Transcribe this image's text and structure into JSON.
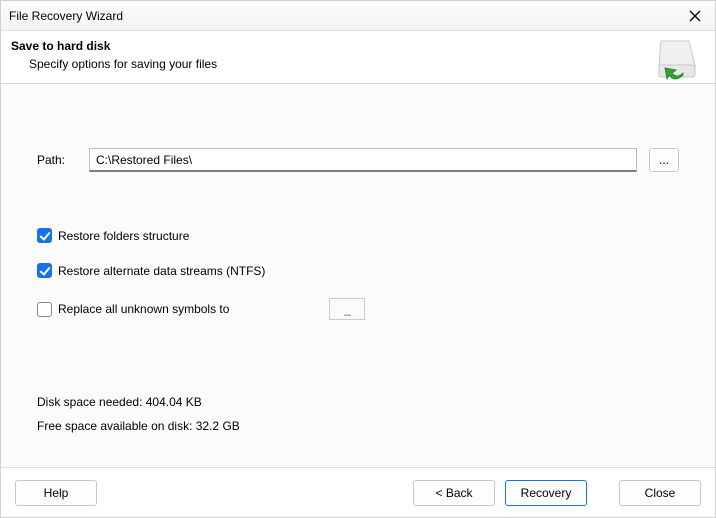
{
  "window": {
    "title": "File Recovery Wizard"
  },
  "header": {
    "title": "Save to hard disk",
    "subtitle": "Specify options for saving your files"
  },
  "path": {
    "label": "Path:",
    "value": "C:\\Restored Files\\",
    "browse_label": "..."
  },
  "options": {
    "restore_folders": {
      "checked": true,
      "label": "Restore folders structure"
    },
    "restore_ads": {
      "checked": true,
      "label": "Restore alternate data streams (NTFS)"
    },
    "replace_symbols": {
      "checked": false,
      "label": "Replace all unknown symbols to",
      "value": "_"
    }
  },
  "disk": {
    "needed_label": "Disk space needed: 404.04 KB",
    "free_label": "Free space available on disk: 32.2 GB"
  },
  "footer": {
    "help": "Help",
    "back": "< Back",
    "recovery": "Recovery",
    "close": "Close"
  }
}
